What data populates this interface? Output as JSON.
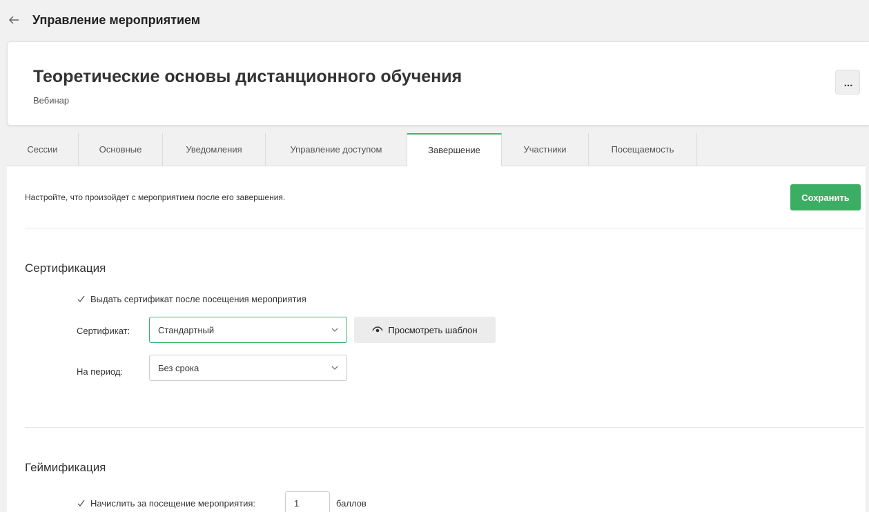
{
  "header": {
    "title": "Управление мероприятием"
  },
  "event": {
    "title": "Теоретические основы дистанционного обучения",
    "type": "Вебинар",
    "more_label": "..."
  },
  "tabs": [
    {
      "label": "Сессии"
    },
    {
      "label": "Основные"
    },
    {
      "label": "Уведомления"
    },
    {
      "label": "Управление доступом"
    },
    {
      "label": "Завершение",
      "active": true
    },
    {
      "label": "Участники"
    },
    {
      "label": "Посещаемость"
    }
  ],
  "completion": {
    "intro": "Настройте, что произойдет с мероприятием после его завершения.",
    "save_label": "Сохранить"
  },
  "certification": {
    "title": "Сертификация",
    "issue_checkbox": {
      "label": "Выдать сертификат после посещения мероприятия",
      "checked": true
    },
    "certificate": {
      "label": "Сертификат:",
      "value": "Стандартный"
    },
    "preview_label": "Просмотреть шаблон",
    "period": {
      "label": "На период:",
      "value": "Без срока"
    }
  },
  "gamification": {
    "title": "Геймификация",
    "points_checkbox": {
      "label": "Начислить за посещение мероприятия:",
      "checked": true
    },
    "points_value": "1",
    "points_unit": "баллов"
  },
  "colors": {
    "accent": "#3cae64",
    "background": "#f1f1f1"
  },
  "icons": {
    "back": "arrow-left-icon",
    "check": "check-icon",
    "chevron": "chevron-down-icon",
    "eye": "eye-icon"
  }
}
